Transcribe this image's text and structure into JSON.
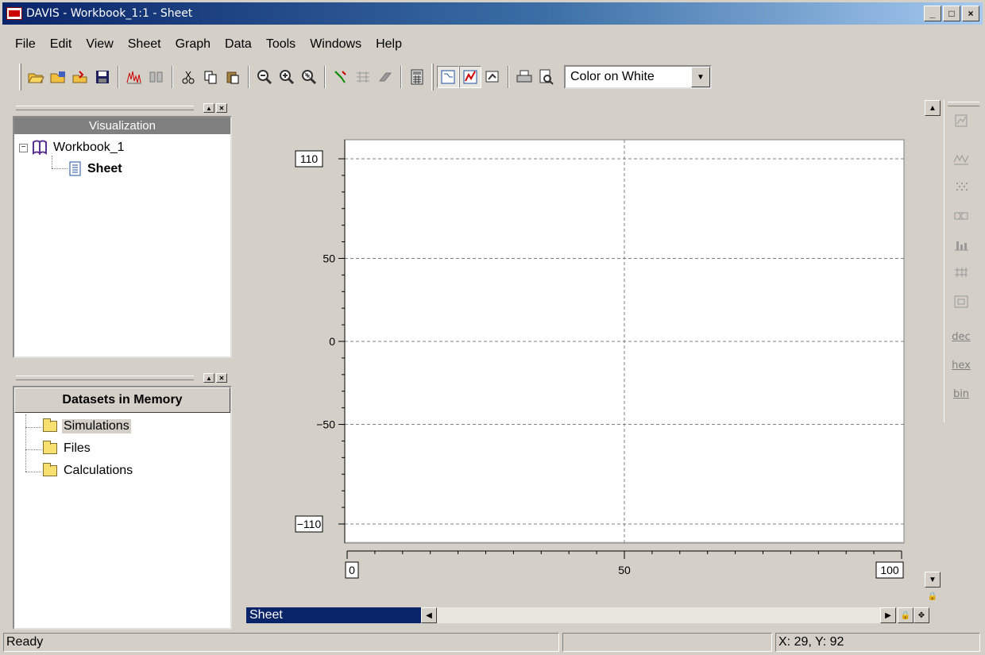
{
  "window": {
    "title": "DAVIS - Workbook_1:1 - Sheet",
    "min_label": "_",
    "max_label": "□",
    "close_label": "×"
  },
  "menu": [
    "File",
    "Edit",
    "View",
    "Sheet",
    "Graph",
    "Data",
    "Tools",
    "Windows",
    "Help"
  ],
  "toolbar": {
    "color_scheme": "Color on White",
    "icons": [
      "open-icon",
      "open-workbook-icon",
      "import-icon",
      "save-icon",
      "waveform-icon",
      "columns-icon",
      "cut-icon",
      "copy-icon",
      "paste-icon",
      "zoom-out-icon",
      "zoom-in-icon",
      "zoom-fit-icon",
      "probe-icon",
      "grid-icon",
      "eraser-icon",
      "calculator-icon",
      "select-mode-icon",
      "graph-mode-icon",
      "chart-icon",
      "print-icon",
      "print-preview-icon"
    ]
  },
  "visualization_panel": {
    "header": "Visualization",
    "workbook": "Workbook_1",
    "sheet": "Sheet"
  },
  "datasets_panel": {
    "header": "Datasets in Memory",
    "items": [
      "Simulations",
      "Files",
      "Calculations"
    ]
  },
  "chart_data": {
    "type": "line",
    "series": [],
    "title": "",
    "xlabel": "",
    "ylabel": "",
    "xlim": [
      0,
      100
    ],
    "ylim": [
      -110,
      110
    ],
    "x_ticks": [
      "0",
      "50",
      "100"
    ],
    "y_ticks": [
      "110",
      "50",
      "0",
      "-50",
      "-110"
    ],
    "grid": true
  },
  "sheet_tab": "Sheet",
  "right_toolbar": [
    "graph-props-icon",
    "waveform-view-icon",
    "dots-icon",
    "box-icon",
    "histogram-icon",
    "bus-icon",
    "table-icon",
    "dec",
    "hex",
    "bin"
  ],
  "status": {
    "left": "Ready",
    "middle": "",
    "coords": "X: 29, Y: 92"
  }
}
